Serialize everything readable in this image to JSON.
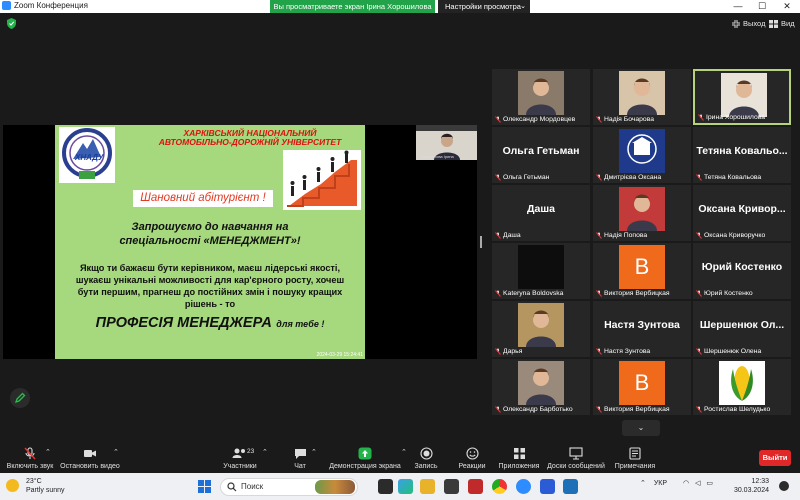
{
  "window": {
    "app_title": "Zoom Конференция",
    "share_banner": "Вы просматриваете экран Ірина Хорошилова",
    "view_options": "Настройки просмотра",
    "view_options_caret": "⌄",
    "minimize": "—",
    "maximize": "☐",
    "close": "✕"
  },
  "top": {
    "exit_label": "Выход",
    "view_label": "Вид"
  },
  "slide": {
    "university_line1": "ХАРКІВСЬКИЙ НАЦІОНАЛЬНИЙ",
    "university_line2": "АВТОМОБІЛЬНО-ДОРОЖНІЙ УНІВЕРСИТЕТ",
    "logo_text": "ХНАДУ",
    "greeting": "Шановний абітурієнт !",
    "invite_line1": "Запрошуємо до навчання на",
    "invite_line2": "спеціальності «МЕНЕДЖМЕНТ»!",
    "body_text": "Якщо ти бажаєш бути керівником, маєш лідерські якості, шукаєш унікальні можливості для кар'єрного росту, хочеш бути першим, прагнеш до постійних змін і пошуку кращих рішень - то",
    "profession": "ПРОФЕСІЯ МЕНЕДЖЕРА",
    "profession_tail": "для тебе !",
    "timestamp": "2024-03-29 15:24:41",
    "presenter_cam_name": "Хорошилова Ірина"
  },
  "participants": [
    {
      "name": "Олександр Мордовцев",
      "display": "",
      "kind": "photo",
      "color": "#8a7a6a"
    },
    {
      "name": "Надія Бочарова",
      "display": "",
      "kind": "photo",
      "color": "#d8c4a8"
    },
    {
      "name": "Ірина Хорошилова",
      "display": "",
      "kind": "photo",
      "color": "#e8e2d8",
      "active": true
    },
    {
      "name": "Ольга Гетьман",
      "display": "Ольга Гетьман",
      "kind": "name"
    },
    {
      "name": "Дмитрієва Оксана",
      "display": "",
      "kind": "logo"
    },
    {
      "name": "Тетяна Ковальова",
      "display": "Тетяна Ковальо...",
      "kind": "name"
    },
    {
      "name": "Даша",
      "display": "Даша",
      "kind": "name"
    },
    {
      "name": "Надія Попова",
      "display": "",
      "kind": "photo",
      "color": "#c23a3a"
    },
    {
      "name": "Оксана Криворучко",
      "display": "Оксана Кривор...",
      "kind": "name"
    },
    {
      "name": "Kateryna Boldovska",
      "display": "",
      "kind": "dark"
    },
    {
      "name": "Виктория Вербицкая",
      "display": "",
      "kind": "letter",
      "letter": "B"
    },
    {
      "name": "Юрий Костенко",
      "display": "Юрий Костенко",
      "kind": "name"
    },
    {
      "name": "Дарья",
      "display": "",
      "kind": "photo",
      "color": "#b59660"
    },
    {
      "name": "Настя Зунтова",
      "display": "Настя Зунтова",
      "kind": "name"
    },
    {
      "name": "Шершенюк Олена",
      "display": "Шершенюк Ол...",
      "kind": "name"
    },
    {
      "name": "Олександр Барботько",
      "display": "",
      "kind": "photo",
      "color": "#9a8a7c"
    },
    {
      "name": "Виктория Вербицкая",
      "display": "",
      "kind": "letter",
      "letter": "B"
    },
    {
      "name": "Ростислав Шелудько",
      "display": "",
      "kind": "corn"
    }
  ],
  "more_arrow": "⌄",
  "toolbar": {
    "unmute": "Включить звук",
    "start_video": "Остановить видео",
    "participants": "Участники",
    "participants_count": "23",
    "chat": "Чат",
    "share_screen": "Демонстрация экрана",
    "record": "Запись",
    "reactions": "Реакции",
    "apps": "Приложения",
    "whiteboards": "Доски сообщений",
    "notes": "Примечания",
    "leave": "Выйти"
  },
  "taskbar": {
    "weather_temp": "23°C",
    "weather_desc": "Partly sunny",
    "search_placeholder": "Поиск",
    "lang": "УКР",
    "time": "12:33",
    "date": "30.03.2024"
  },
  "colors": {
    "share_green": "#22a34a",
    "active_border": "#b6d37a",
    "leave_red": "#e02828",
    "zoom_blue": "#2D8CFF",
    "slide_bg": "#a6d87d",
    "letter_tile": "#f06a1c"
  }
}
